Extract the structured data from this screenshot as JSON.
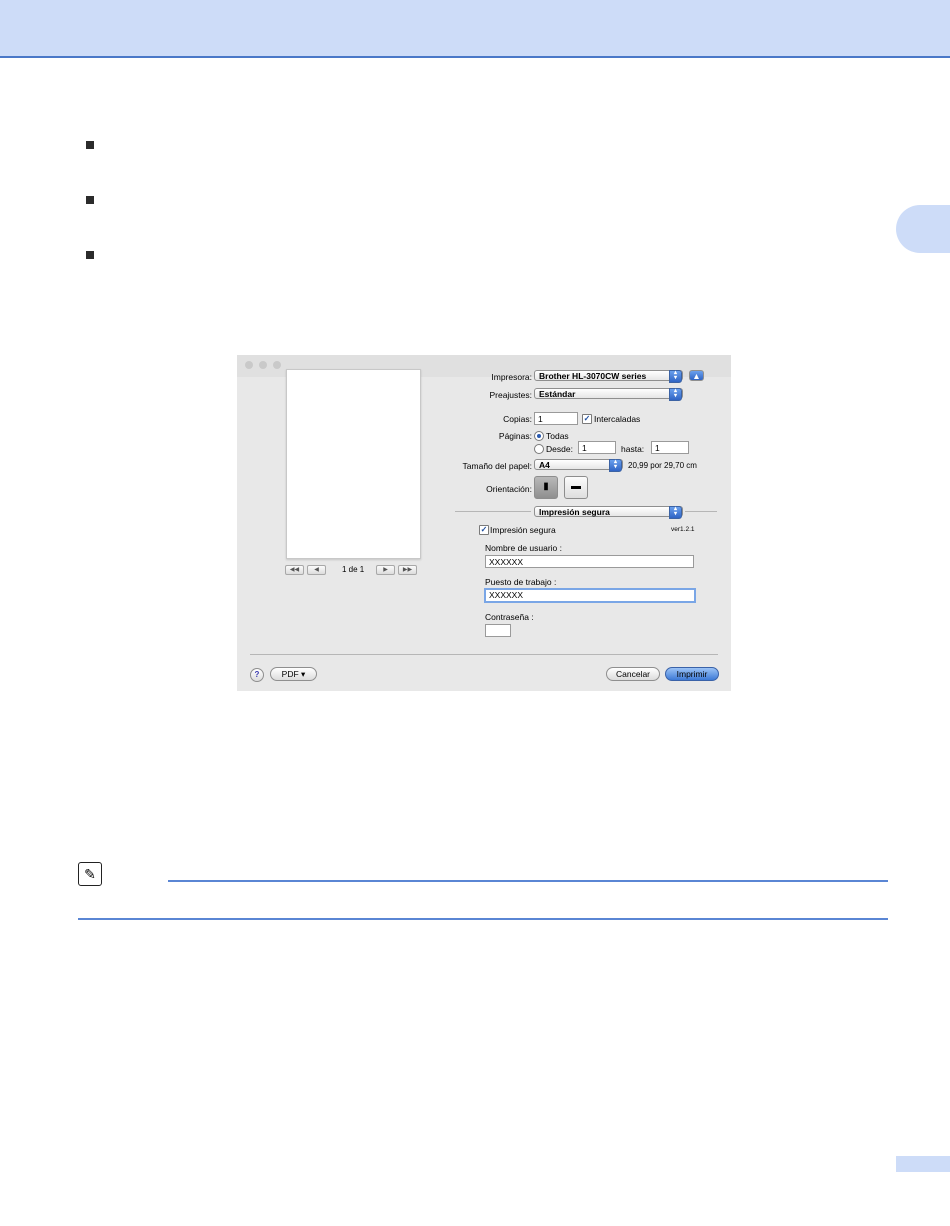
{
  "dialog": {
    "printer_label": "Impresora:",
    "printer_value": "Brother HL-3070CW series",
    "presets_label": "Preajustes:",
    "presets_value": "Estándar",
    "copies_label": "Copias:",
    "copies_value": "1",
    "collated_label": "Intercaladas",
    "pages_label": "Páginas:",
    "pages_all": "Todas",
    "pages_from": "Desde:",
    "from_value": "1",
    "to_label": "hasta:",
    "to_value": "1",
    "paper_label": "Tamaño del papel:",
    "paper_value": "A4",
    "paper_dims": "20,99 por 29,70 cm",
    "orientation_label": "Orientación:",
    "panel_value": "Impresión segura",
    "secure_label": "Impresión segura",
    "version": "ver1.2.1",
    "user_label": "Nombre de usuario :",
    "user_value": "XXXXXX",
    "job_label": "Puesto de trabajo :",
    "job_value": "XXXXXX",
    "password_label": "Contraseña :",
    "page_counter": "1 de 1",
    "pdf_label": "PDF ▾",
    "help_label": "?",
    "cancel_label": "Cancelar",
    "print_label": "Imprimir"
  },
  "colors": {
    "header_band": "#cddcf8",
    "accent_blue": "#4a78c8"
  }
}
